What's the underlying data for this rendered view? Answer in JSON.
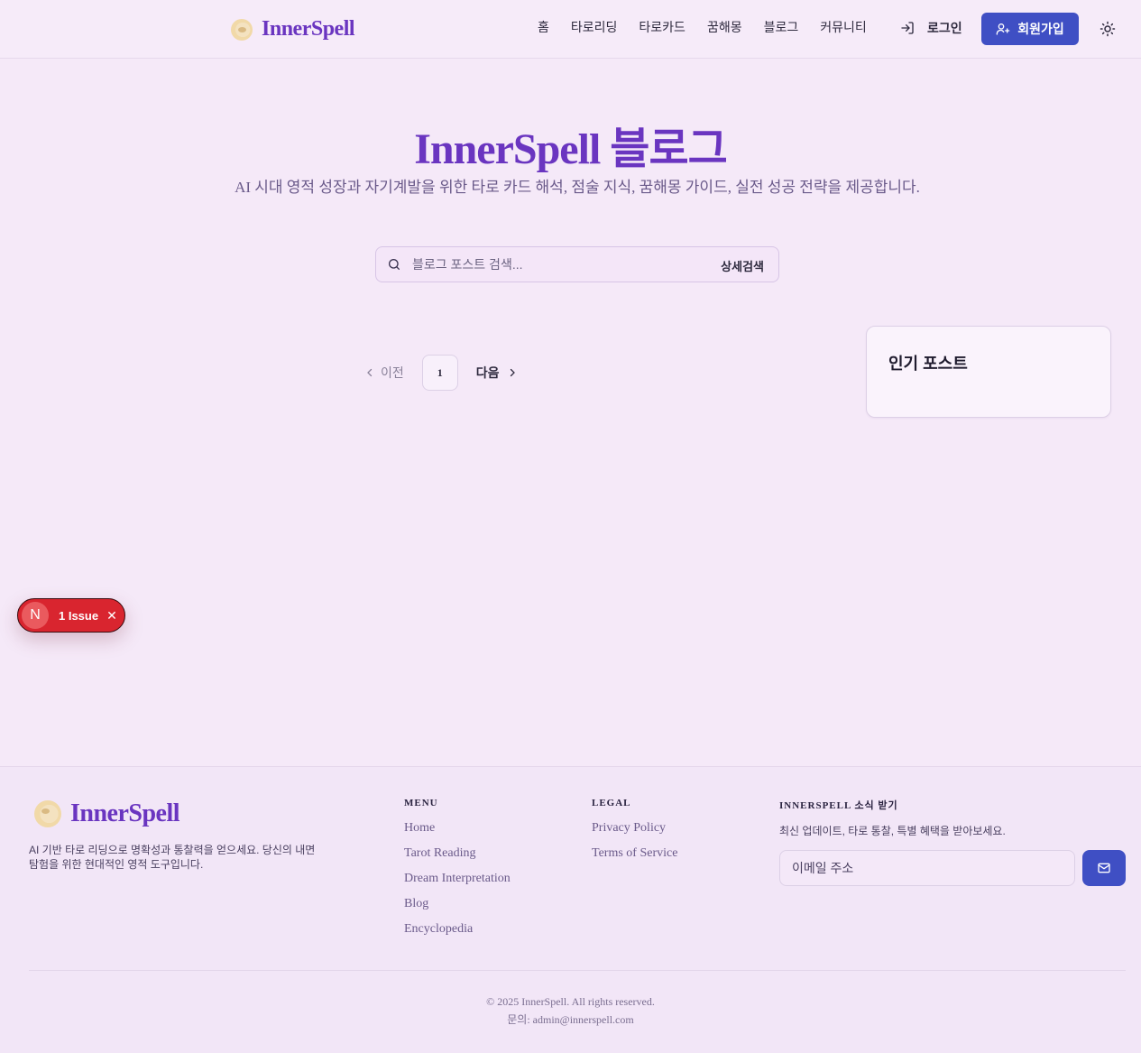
{
  "header": {
    "brand": "InnerSpell",
    "nav": [
      "홈",
      "타로리딩",
      "타로카드",
      "꿈해몽",
      "블로그",
      "커뮤니티"
    ],
    "login": "로그인",
    "signup": "회원가입"
  },
  "hero": {
    "title": "InnerSpell 블로그",
    "subtitle": "AI 시대 영적 성장과 자기계발을 위한 타로 카드 해석, 점술 지식, 꿈해몽 가이드, 실전 성공 전략을 제공합니다."
  },
  "search": {
    "placeholder": "블로그 포스트 검색...",
    "advanced": "상세검색"
  },
  "pagination": {
    "prev": "이전",
    "current": "1",
    "next": "다음"
  },
  "popular": {
    "title": "인기 포스트"
  },
  "issue": {
    "badge": "N",
    "label": "1 Issue"
  },
  "footer": {
    "brand": "InnerSpell",
    "description": "AI 기반 타로 리딩으로 명확성과 통찰력을 얻으세요. 당신의 내면 탐험을 위한 현대적인 영적 도구입니다.",
    "menu": {
      "heading": "MENU",
      "links": [
        "Home",
        "Tarot Reading",
        "Dream Interpretation",
        "Blog",
        "Encyclopedia"
      ]
    },
    "legal": {
      "heading": "LEGAL",
      "links": [
        "Privacy Policy",
        "Terms of Service"
      ]
    },
    "newsletter": {
      "heading": "INNERSPELL 소식 받기",
      "text": "최신 업데이트, 타로 통찰, 특별 혜택을 받아보세요.",
      "placeholder": "이메일 주소"
    },
    "copyright": "© 2025 InnerSpell. All rights reserved.",
    "contact": "문의: admin@innerspell.com"
  },
  "colors": {
    "brand": "#6a35c0",
    "primary_button": "#3f4fc4",
    "background": "#f5e9f8",
    "issue": "#d9252f"
  }
}
